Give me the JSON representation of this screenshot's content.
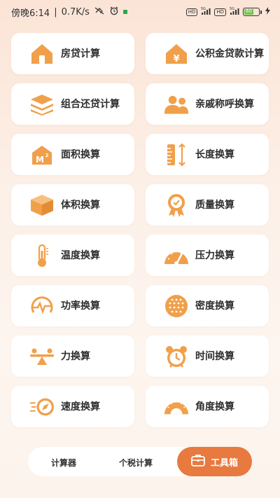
{
  "status_bar": {
    "time": "傍晚6:14",
    "speed": "0.7K/s",
    "hd1": "HD",
    "net1": "5G",
    "hd2": "HD",
    "net2": "5G",
    "battery": "60"
  },
  "tools": [
    {
      "label": "房贷计算",
      "icon": "house-icon"
    },
    {
      "label": "公积金贷款计算",
      "icon": "house-yuan-icon"
    },
    {
      "label": "组合还贷计算",
      "icon": "stack-layers-icon"
    },
    {
      "label": "亲戚称呼换算",
      "icon": "people-icon"
    },
    {
      "label": "面积换算",
      "icon": "area-house-icon"
    },
    {
      "label": "长度换算",
      "icon": "ruler-icon"
    },
    {
      "label": "体积换算",
      "icon": "cube-icon"
    },
    {
      "label": "质量换算",
      "icon": "badge-icon"
    },
    {
      "label": "温度换算",
      "icon": "thermometer-icon"
    },
    {
      "label": "压力换算",
      "icon": "gauge-icon"
    },
    {
      "label": "功率换算",
      "icon": "power-pulse-icon"
    },
    {
      "label": "密度换算",
      "icon": "density-dots-icon"
    },
    {
      "label": "力换算",
      "icon": "seesaw-icon"
    },
    {
      "label": "时间换算",
      "icon": "alarm-clock-icon"
    },
    {
      "label": "速度换算",
      "icon": "speed-compass-icon"
    },
    {
      "label": "角度换算",
      "icon": "protractor-icon"
    }
  ],
  "bottom_nav": {
    "calc": "计算器",
    "tax": "个税计算",
    "tools": "工具箱"
  },
  "colors": {
    "accent": "#e8793f",
    "icon": "#f0a04b"
  }
}
